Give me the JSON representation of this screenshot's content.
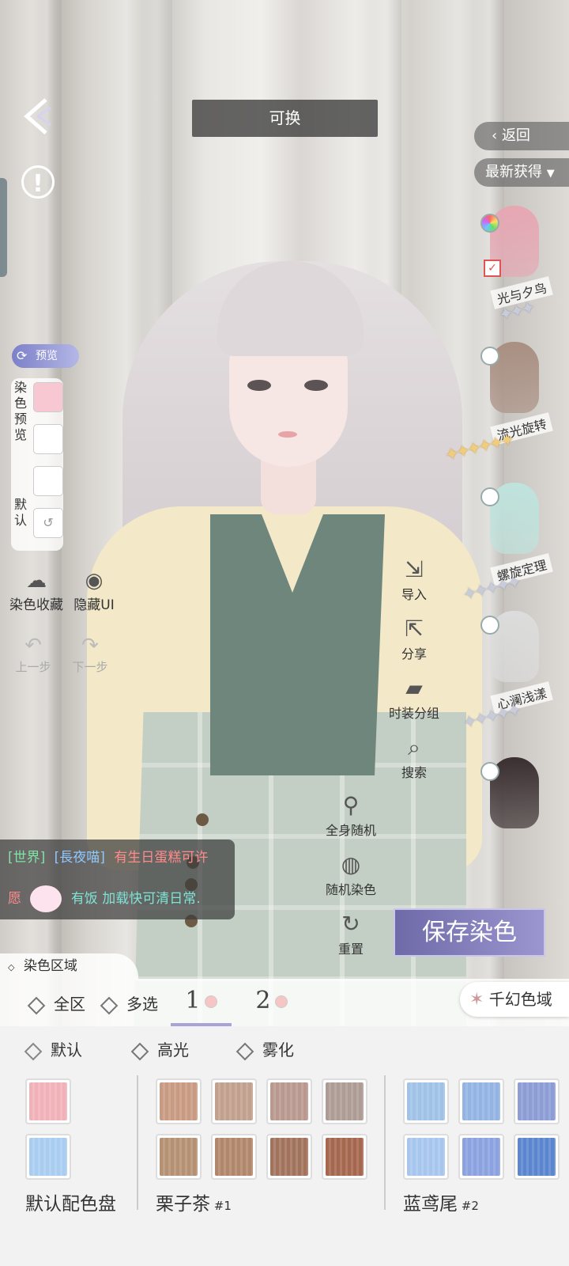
{
  "header": {
    "title": "可换"
  },
  "right_panel": {
    "return_label": "返回",
    "filter_label": "最新获得",
    "hair_items": [
      {
        "name": "光与夕鸟",
        "stars": 3,
        "star_type": "silver",
        "color": "#e6a7b3"
      },
      {
        "name": "流光旋转",
        "stars": 6,
        "star_type": "gold",
        "color": "#a98f82"
      },
      {
        "name": "螺旋定理",
        "stars": 5,
        "star_type": "silver",
        "color": "#bfe3dd"
      },
      {
        "name": "心澜浅漾",
        "stars": 5,
        "star_type": "silver",
        "color": "#dcdcdc"
      },
      {
        "name": "",
        "stars": 0,
        "star_type": "",
        "color": "#3a2f31"
      }
    ]
  },
  "left_panel": {
    "preview_label": "预览",
    "dye_preview_label": "染色预览",
    "default_label": "默认",
    "fav_label": "染色收藏",
    "hide_ui_label": "隐藏UI",
    "undo_label": "上一步",
    "redo_label": "下一步"
  },
  "mid_tools": {
    "import_label": "导入",
    "share_label": "分享",
    "group_label": "时装分组",
    "search_label": "搜索",
    "random_body_label": "全身随机",
    "random_dye_label": "随机染色",
    "reset_label": "重置",
    "save_label": "保存染色"
  },
  "chat": {
    "channel": "[世界]",
    "user": "[長夜喵]",
    "line1": "有生日蛋糕可许",
    "line2_prefix": "愿",
    "line2": "有饭 加载快可清日常."
  },
  "dye_area": {
    "label": "染色区域",
    "tabs": [
      "全区",
      "多选"
    ],
    "slots": [
      "1",
      "2"
    ],
    "fantasy_label": "千幻色域",
    "modes": [
      "默认",
      "高光",
      "雾化"
    ]
  },
  "palettes": [
    {
      "name": "默认配色盘",
      "code": "",
      "colors": [
        "#f0b2b8",
        "#a9cdf0"
      ]
    },
    {
      "name": "栗子茶",
      "code": "#1",
      "colors": [
        "#c89a82",
        "#c2a08e",
        "#b9998f",
        "#ad9c95",
        "#b59174",
        "#b0876a",
        "#a1735d",
        "#a6674f"
      ]
    },
    {
      "name": "蓝鸢尾",
      "code": "#2",
      "colors": [
        "#9fc2e6",
        "#93b4e2",
        "#8c9cd4",
        "#a7c6ee",
        "#8aa2e0",
        "#5b86cf"
      ]
    }
  ]
}
